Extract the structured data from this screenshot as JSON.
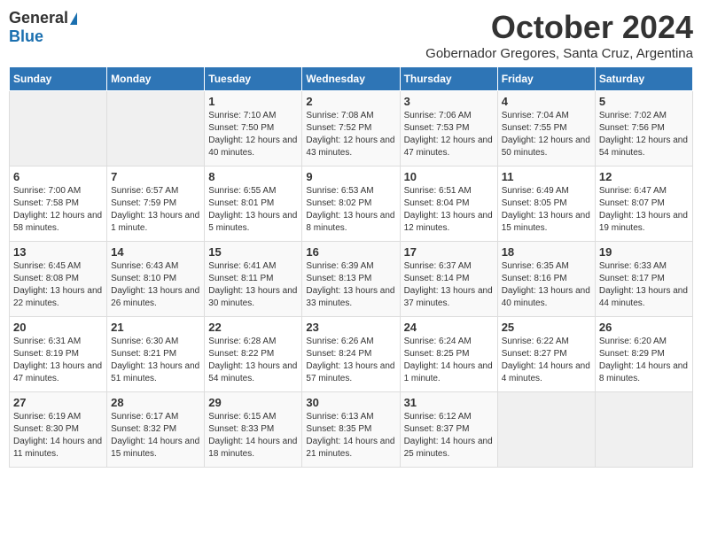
{
  "logo": {
    "general": "General",
    "blue": "Blue"
  },
  "title": "October 2024",
  "subtitle": "Gobernador Gregores, Santa Cruz, Argentina",
  "days_of_week": [
    "Sunday",
    "Monday",
    "Tuesday",
    "Wednesday",
    "Thursday",
    "Friday",
    "Saturday"
  ],
  "weeks": [
    [
      {
        "day": "",
        "info": ""
      },
      {
        "day": "",
        "info": ""
      },
      {
        "day": "1",
        "info": "Sunrise: 7:10 AM\nSunset: 7:50 PM\nDaylight: 12 hours and 40 minutes."
      },
      {
        "day": "2",
        "info": "Sunrise: 7:08 AM\nSunset: 7:52 PM\nDaylight: 12 hours and 43 minutes."
      },
      {
        "day": "3",
        "info": "Sunrise: 7:06 AM\nSunset: 7:53 PM\nDaylight: 12 hours and 47 minutes."
      },
      {
        "day": "4",
        "info": "Sunrise: 7:04 AM\nSunset: 7:55 PM\nDaylight: 12 hours and 50 minutes."
      },
      {
        "day": "5",
        "info": "Sunrise: 7:02 AM\nSunset: 7:56 PM\nDaylight: 12 hours and 54 minutes."
      }
    ],
    [
      {
        "day": "6",
        "info": "Sunrise: 7:00 AM\nSunset: 7:58 PM\nDaylight: 12 hours and 58 minutes."
      },
      {
        "day": "7",
        "info": "Sunrise: 6:57 AM\nSunset: 7:59 PM\nDaylight: 13 hours and 1 minute."
      },
      {
        "day": "8",
        "info": "Sunrise: 6:55 AM\nSunset: 8:01 PM\nDaylight: 13 hours and 5 minutes."
      },
      {
        "day": "9",
        "info": "Sunrise: 6:53 AM\nSunset: 8:02 PM\nDaylight: 13 hours and 8 minutes."
      },
      {
        "day": "10",
        "info": "Sunrise: 6:51 AM\nSunset: 8:04 PM\nDaylight: 13 hours and 12 minutes."
      },
      {
        "day": "11",
        "info": "Sunrise: 6:49 AM\nSunset: 8:05 PM\nDaylight: 13 hours and 15 minutes."
      },
      {
        "day": "12",
        "info": "Sunrise: 6:47 AM\nSunset: 8:07 PM\nDaylight: 13 hours and 19 minutes."
      }
    ],
    [
      {
        "day": "13",
        "info": "Sunrise: 6:45 AM\nSunset: 8:08 PM\nDaylight: 13 hours and 22 minutes."
      },
      {
        "day": "14",
        "info": "Sunrise: 6:43 AM\nSunset: 8:10 PM\nDaylight: 13 hours and 26 minutes."
      },
      {
        "day": "15",
        "info": "Sunrise: 6:41 AM\nSunset: 8:11 PM\nDaylight: 13 hours and 30 minutes."
      },
      {
        "day": "16",
        "info": "Sunrise: 6:39 AM\nSunset: 8:13 PM\nDaylight: 13 hours and 33 minutes."
      },
      {
        "day": "17",
        "info": "Sunrise: 6:37 AM\nSunset: 8:14 PM\nDaylight: 13 hours and 37 minutes."
      },
      {
        "day": "18",
        "info": "Sunrise: 6:35 AM\nSunset: 8:16 PM\nDaylight: 13 hours and 40 minutes."
      },
      {
        "day": "19",
        "info": "Sunrise: 6:33 AM\nSunset: 8:17 PM\nDaylight: 13 hours and 44 minutes."
      }
    ],
    [
      {
        "day": "20",
        "info": "Sunrise: 6:31 AM\nSunset: 8:19 PM\nDaylight: 13 hours and 47 minutes."
      },
      {
        "day": "21",
        "info": "Sunrise: 6:30 AM\nSunset: 8:21 PM\nDaylight: 13 hours and 51 minutes."
      },
      {
        "day": "22",
        "info": "Sunrise: 6:28 AM\nSunset: 8:22 PM\nDaylight: 13 hours and 54 minutes."
      },
      {
        "day": "23",
        "info": "Sunrise: 6:26 AM\nSunset: 8:24 PM\nDaylight: 13 hours and 57 minutes."
      },
      {
        "day": "24",
        "info": "Sunrise: 6:24 AM\nSunset: 8:25 PM\nDaylight: 14 hours and 1 minute."
      },
      {
        "day": "25",
        "info": "Sunrise: 6:22 AM\nSunset: 8:27 PM\nDaylight: 14 hours and 4 minutes."
      },
      {
        "day": "26",
        "info": "Sunrise: 6:20 AM\nSunset: 8:29 PM\nDaylight: 14 hours and 8 minutes."
      }
    ],
    [
      {
        "day": "27",
        "info": "Sunrise: 6:19 AM\nSunset: 8:30 PM\nDaylight: 14 hours and 11 minutes."
      },
      {
        "day": "28",
        "info": "Sunrise: 6:17 AM\nSunset: 8:32 PM\nDaylight: 14 hours and 15 minutes."
      },
      {
        "day": "29",
        "info": "Sunrise: 6:15 AM\nSunset: 8:33 PM\nDaylight: 14 hours and 18 minutes."
      },
      {
        "day": "30",
        "info": "Sunrise: 6:13 AM\nSunset: 8:35 PM\nDaylight: 14 hours and 21 minutes."
      },
      {
        "day": "31",
        "info": "Sunrise: 6:12 AM\nSunset: 8:37 PM\nDaylight: 14 hours and 25 minutes."
      },
      {
        "day": "",
        "info": ""
      },
      {
        "day": "",
        "info": ""
      }
    ]
  ]
}
